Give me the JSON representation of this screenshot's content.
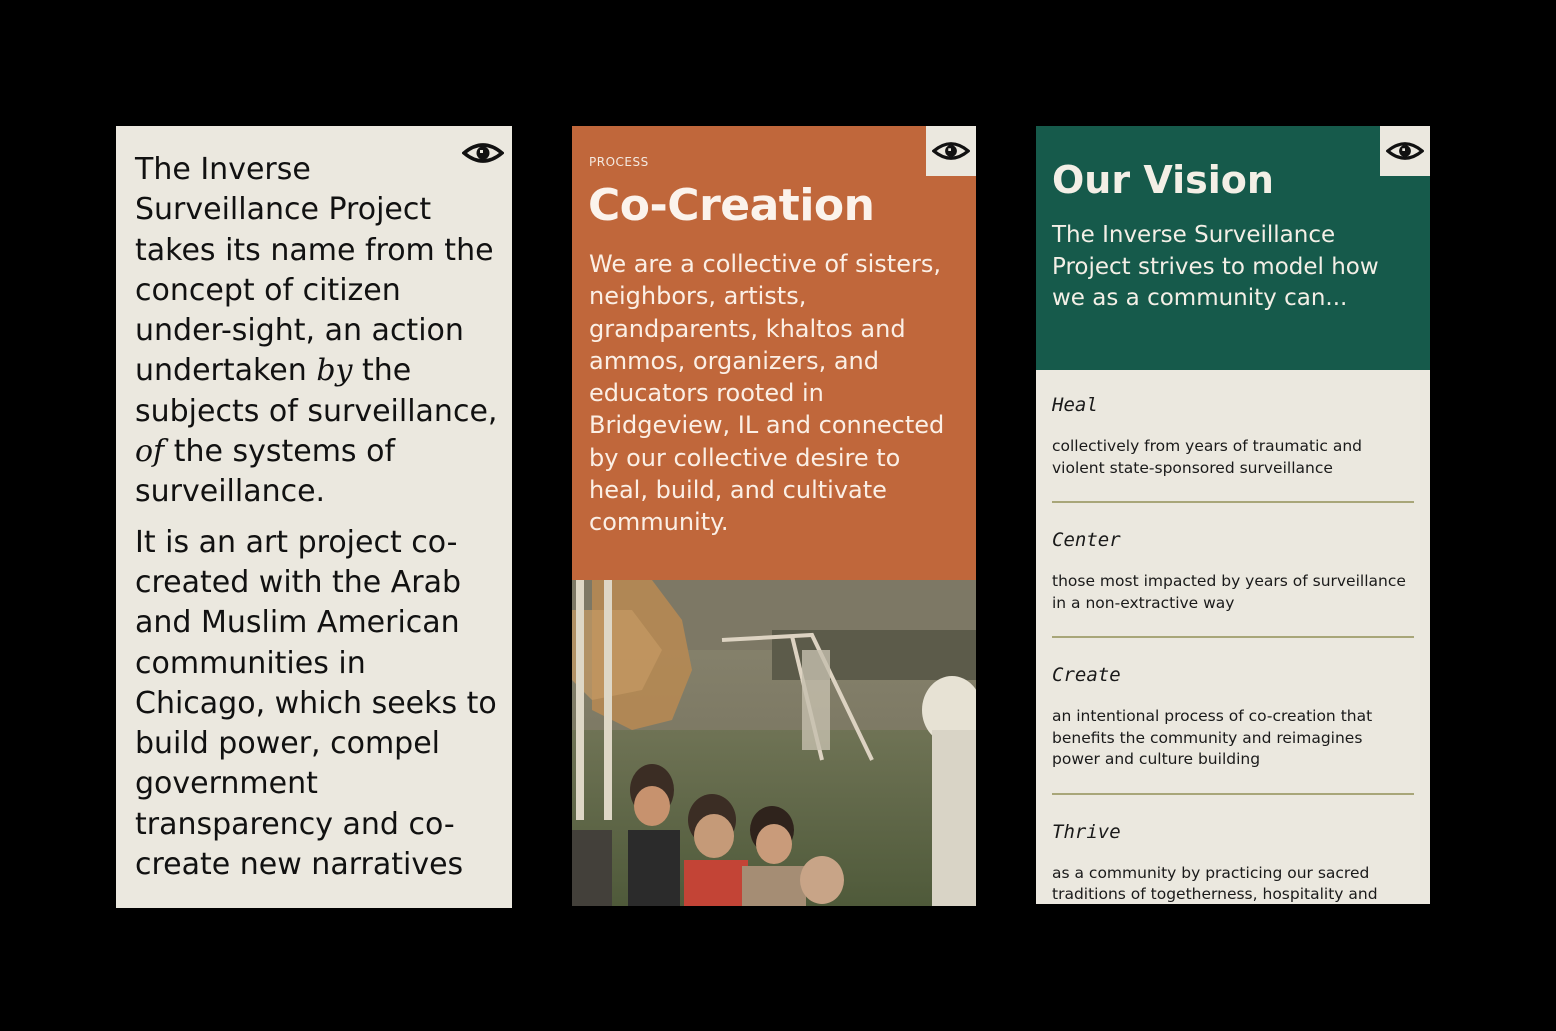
{
  "panel1": {
    "eye_icon": "eye-icon",
    "para1": {
      "pre_by": "The Inverse Surveillance Project takes its name from the concept of citizen under-sight, an action undertaken ",
      "em_by": "by",
      "mid": " the subjects of surveillance, ",
      "em_of": "of",
      "post": " the systems of surveillance."
    },
    "para2": "It is an art project co-created with the Arab and Muslim American communities in Chicago, which seeks to build power, compel government transparency and co-create new narratives"
  },
  "panel2": {
    "eye_icon": "eye-icon",
    "eyebrow": "PROCESS",
    "title": "Co-Creation",
    "body": "We are a collective of sisters, neighbors, artists, grandparents, khaltos and ammos, organizers, and educators rooted in Bridgeview, IL and connected by our collective desire to heal, build, and cultivate community."
  },
  "panel3": {
    "eye_icon": "eye-icon",
    "title": "Our Vision",
    "intro": "The Inverse Surveillance Project strives to model how we as a community can...",
    "items": [
      {
        "head": "Heal",
        "desc": "collectively from years of traumatic and violent state-sponsored surveillance"
      },
      {
        "head": "Center",
        "desc": "those most impacted by years of surveillance in a non-extractive way"
      },
      {
        "head": "Create",
        "desc": "an intentional process of co-creation that benefits the community and reimagines power and culture building"
      },
      {
        "head": "Thrive",
        "desc": "as a community by practicing our sacred traditions of togetherness, hospitality and creating art"
      }
    ]
  },
  "colors": {
    "background": "#000000",
    "cream": "#ebe8df",
    "orange": "#c0673b",
    "green": "#165a4b",
    "divider": "#a8a679"
  }
}
